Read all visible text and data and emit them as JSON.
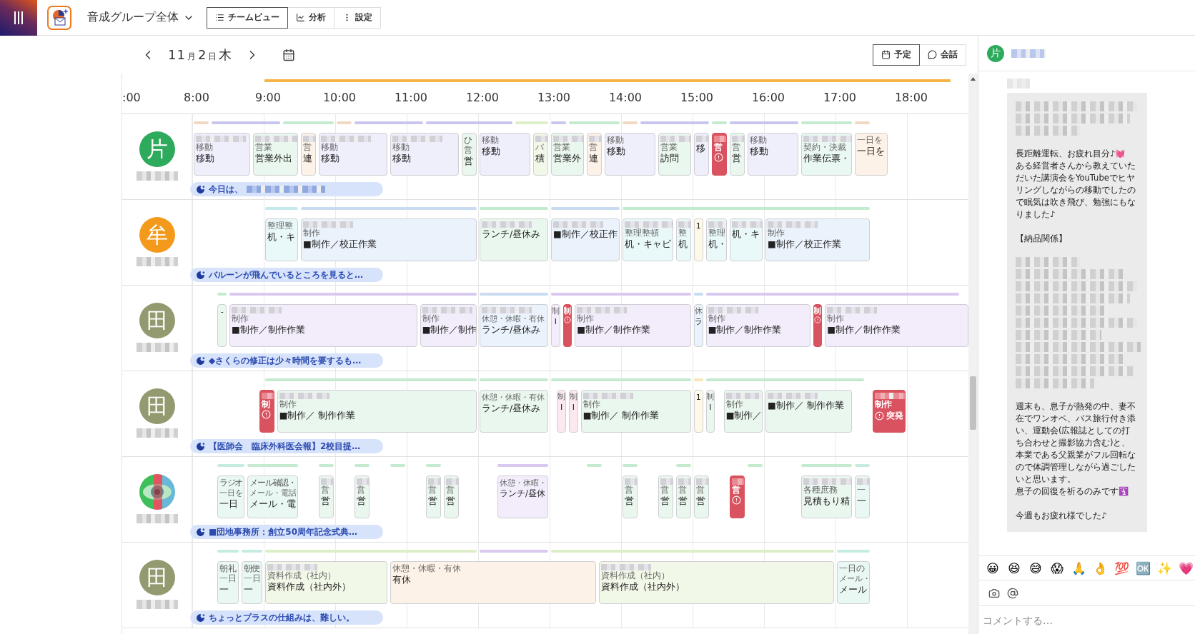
{
  "app_bar": {
    "group_select": "音成グループ全体",
    "tabs": [
      {
        "label": "チームビュー",
        "kind": "list",
        "selected": true
      },
      {
        "label": "分析",
        "kind": "chart",
        "selected": false
      },
      {
        "label": "設定",
        "kind": "more",
        "selected": false
      }
    ]
  },
  "date_nav": {
    "month": "11",
    "month_unit": "月",
    "day": "2",
    "day_unit": "日",
    "weekday": "木"
  },
  "view_toggle": [
    {
      "label": "予定",
      "kind": "calendar",
      "selected": true
    },
    {
      "label": "会話",
      "kind": "chat",
      "selected": false
    }
  ],
  "timeline": {
    "hours": [
      ":00",
      "8:00",
      "9:00",
      "10:00",
      "11:00",
      "12:00",
      "13:00",
      "14:00",
      "15:00",
      "16:00",
      "17:00",
      "18:00"
    ],
    "rows": [
      {
        "avatar": {
          "kind": "initial",
          "text": "片",
          "color": "#2eaa5c"
        },
        "bars": [
          {
            "color": "#f0d9c2"
          },
          {
            "color": "#c8c5ee"
          },
          {
            "color": "#c4ebcf"
          },
          {
            "color": "#f0d9c2"
          },
          {
            "color": "#c8c5ee"
          },
          {
            "color": "#c8c5ee"
          },
          {
            "color": "#dcefc8"
          },
          {
            "color": "#c8c5ee"
          },
          {
            "color": "#c4ebcf"
          },
          {
            "color": "#f0d9c2"
          },
          {
            "color": "#c8c5ee"
          },
          {
            "color": "#c4ebcf"
          },
          {
            "color": "#c8c5ee"
          },
          {
            "color": "#c4ebcf"
          },
          {
            "color": "#f0d9c2"
          }
        ],
        "events": [
          {
            "kind": "task",
            "color": "#efeefb",
            "title_redacted": true,
            "category": "移動",
            "text": "移動"
          },
          {
            "kind": "task",
            "color": "#eaf7ee",
            "title_redacted": true,
            "category": "営業",
            "text": "営業外出"
          },
          {
            "kind": "task",
            "color": "#fdf2e7",
            "title_redacted": true,
            "category": "営",
            "text": "連"
          },
          {
            "kind": "task",
            "color": "#efeefb",
            "title_redacted": true,
            "category": "移動",
            "text": "移動"
          },
          {
            "kind": "task",
            "color": "#efeefb",
            "title_redacted": true,
            "category": "移動",
            "text": "移動"
          },
          {
            "kind": "task",
            "color": "#eaf7ee",
            "title": "ひ",
            "category": "営",
            "text": "営"
          },
          {
            "kind": "task",
            "color": "#efeefb",
            "category": "移動",
            "text": "移動"
          },
          {
            "kind": "task",
            "color": "#f2f8e8",
            "title_redacted": true,
            "category": "バ",
            "text": "積"
          },
          {
            "kind": "task",
            "color": "#eaf7ee",
            "title_redacted": true,
            "category": "営業",
            "text": "営業外"
          },
          {
            "kind": "task",
            "color": "#fdf2e7",
            "title_redacted": true,
            "category": "営",
            "text": "連"
          },
          {
            "kind": "task",
            "color": "#efeefb",
            "category": "移動",
            "text": "移動"
          },
          {
            "kind": "task",
            "color": "#eaf7ee",
            "title_redacted": true,
            "category": "営業",
            "text": "訪問"
          },
          {
            "kind": "task",
            "color": "#efeefb",
            "title_redacted": true,
            "text": "移"
          },
          {
            "kind": "alert",
            "color": "#d9525f",
            "title_redacted": true,
            "category": "営"
          },
          {
            "kind": "task",
            "color": "#eaf7ee",
            "title_redacted": true,
            "category": "営",
            "text": "営"
          },
          {
            "kind": "task",
            "color": "#efeefb",
            "category": "移動",
            "text": "移動"
          },
          {
            "kind": "task",
            "color": "#eaf8f3",
            "title_redacted": true,
            "category": "契約・決裁",
            "text": "作業伝票・"
          },
          {
            "kind": "task",
            "color": "#fdf2e7",
            "category": "一日を",
            "text": "一日を"
          }
        ],
        "comment": {
          "text": "今日は、",
          "redacted": true
        }
      },
      {
        "avatar": {
          "kind": "initial",
          "text": "牟",
          "color": "#f39a1c"
        },
        "bars": [
          {
            "color": "#c6e9ec"
          },
          {
            "color": "#c8dbf0"
          },
          {
            "color": "#c4ebcf"
          },
          {
            "color": "#c8dbf0"
          },
          {
            "color": "#c4ebcf"
          }
        ],
        "events": [
          {
            "kind": "task",
            "color": "#e9f8f9",
            "category": "整理整",
            "text": "机・キ"
          },
          {
            "kind": "task",
            "color": "#eaf2fb",
            "title_redacted": true,
            "category": "制作",
            "text": "■制作／校正作業"
          },
          {
            "kind": "task",
            "color": "#eaf7ee",
            "title_redacted": true,
            "text": "ランチ/昼休み"
          },
          {
            "kind": "task",
            "color": "#eaf2fb",
            "title_redacted": true,
            "text": "■制作／校正作"
          },
          {
            "kind": "task",
            "color": "#e9f8f9",
            "title_redacted": true,
            "category": "整理整頓",
            "text": "机・キャビ"
          },
          {
            "kind": "task",
            "color": "#e9f8f9",
            "title_redacted": true,
            "category": "整",
            "text": "机"
          },
          {
            "kind": "task",
            "color": "#fdf9e6",
            "text": "1"
          },
          {
            "kind": "task",
            "color": "#e9f8f9",
            "title_redacted": true,
            "category": "整理",
            "text": "机・"
          },
          {
            "kind": "task",
            "color": "#e9f8f9",
            "title_redacted": true,
            "text": "机・キ"
          },
          {
            "kind": "task",
            "color": "#eaf2fb",
            "title_redacted": true,
            "category": "制作",
            "text": "■制作／校正作業"
          }
        ],
        "comment": {
          "text": "バルーンが飛んでいるところを見ると…"
        }
      },
      {
        "avatar": {
          "kind": "initial",
          "text": "田",
          "color": "#949a6f"
        },
        "bars": [
          {
            "color": "#c4ebcf"
          },
          {
            "color": "#d9c8f0"
          },
          {
            "color": "#c8dbf0"
          },
          {
            "color": "#d9c8f0"
          },
          {
            "color": "#c8dbf0"
          },
          {
            "color": "#d9c8f0"
          }
        ],
        "events": [
          {
            "kind": "task",
            "color": "#eaf7ee",
            "text": "-"
          },
          {
            "kind": "task",
            "color": "#f3edfb",
            "title_redacted": true,
            "category": "制作",
            "text": "■制作／制作作業"
          },
          {
            "kind": "task",
            "color": "#f3edfb",
            "title_redacted": true,
            "category": "制作",
            "text": "■制作／制作"
          },
          {
            "kind": "task",
            "color": "#eaf2fb",
            "title_redacted": true,
            "category": "休憩・休暇・有休",
            "text": "ランチ/昼休み"
          },
          {
            "kind": "task",
            "color": "#f3edfb",
            "category": "制",
            "text": "I"
          },
          {
            "kind": "alert",
            "color": "#d9525f",
            "category": "制"
          },
          {
            "kind": "task",
            "color": "#f3edfb",
            "title_redacted": true,
            "category": "制作",
            "text": "■制作／制作作業"
          },
          {
            "kind": "task",
            "color": "#eaf2fb",
            "category": "休",
            "text": "ラ"
          },
          {
            "kind": "task",
            "color": "#f3edfb",
            "title_redacted": true,
            "category": "制作",
            "text": "■制作／制作作業"
          },
          {
            "kind": "alert",
            "color": "#d9525f",
            "category": "制"
          },
          {
            "kind": "task",
            "color": "#f3edfb",
            "title_redacted": true,
            "category": "制作",
            "text": "■制作／制作作業"
          }
        ],
        "comment": {
          "text": "◆さくらの修正は少々時間を要するも…"
        }
      },
      {
        "avatar": {
          "kind": "initial",
          "text": "田",
          "color": "#949a6f"
        },
        "bars": [
          {
            "color": "#c4ebcf"
          },
          {
            "color": "#c4ebcf"
          },
          {
            "color": "#c4ebcf"
          },
          {
            "color": "#f5e8b8"
          },
          {
            "color": "#c4ebcf"
          }
        ],
        "events": [
          {
            "kind": "alert",
            "color": "#d9525f",
            "title_redacted": true,
            "category": "制"
          },
          {
            "kind": "task",
            "color": "#eaf7ee",
            "title_redacted": true,
            "category": "制作",
            "text": "■制作／ 制作作業"
          },
          {
            "kind": "task",
            "color": "#eaf7ee",
            "category": "休憩・休暇・有休",
            "text": "ランチ/昼休み"
          },
          {
            "kind": "task",
            "color": "#fbe9ef",
            "category": "制",
            "text": "I"
          },
          {
            "kind": "task",
            "color": "#fbe9ef",
            "category": "制",
            "text": "I"
          },
          {
            "kind": "task",
            "color": "#eaf7ee",
            "title_redacted": true,
            "category": "制作",
            "text": "■制作／ 制作作業"
          },
          {
            "kind": "task",
            "color": "#fdf9e6",
            "text": "1"
          },
          {
            "kind": "task",
            "color": "#eaf7ee",
            "category": "制",
            "text": "I"
          },
          {
            "kind": "task",
            "color": "#eaf7ee",
            "title_redacted": true,
            "category": "制作",
            "text": "■制作／"
          },
          {
            "kind": "task",
            "color": "#eaf7ee",
            "title_redacted": true,
            "text": "■制作／ 制作作業"
          },
          {
            "kind": "alert",
            "color": "#d9525f",
            "title_redacted": true,
            "category": "制作",
            "note": "突発"
          }
        ],
        "comment": {
          "text": "【医師会　臨床外科医会報】2校目提…"
        }
      },
      {
        "avatar": {
          "kind": "picture"
        },
        "bars": [
          {
            "color": "#c6ece0"
          },
          {
            "color": "#c4ebcf"
          },
          {
            "color": "#c4ebcf"
          },
          {
            "color": "#c4ebcf"
          },
          {
            "color": "#c4ebcf"
          },
          {
            "color": "#c4ebcf"
          },
          {
            "color": "#d9c8f0"
          },
          {
            "color": "#c4ebcf"
          },
          {
            "color": "#c4ebcf"
          },
          {
            "color": "#c4ebcf"
          },
          {
            "color": "#c4ebcf"
          },
          {
            "color": "#c4ebcf"
          },
          {
            "color": "#c6ece0"
          }
        ],
        "events": [
          {
            "kind": "task",
            "color": "#eaf8f3",
            "title": "ラジオ",
            "category": "一日を",
            "text": "一日"
          },
          {
            "kind": "task",
            "color": "#eaf8f3",
            "title": "メール確認・",
            "category": "メール・電話",
            "text": "メール・電"
          },
          {
            "kind": "task",
            "color": "#eaf7ee",
            "title_redacted": true,
            "category": "営",
            "text": "営"
          },
          {
            "kind": "task",
            "color": "#eaf7ee",
            "title_redacted": true,
            "category": "営",
            "text": "営"
          },
          {
            "kind": "task",
            "color": "#eaf7ee",
            "title_redacted": true,
            "category": "営",
            "text": "営"
          },
          {
            "kind": "task",
            "color": "#eaf7ee",
            "title_redacted": true,
            "category": "営",
            "text": "営"
          },
          {
            "kind": "task",
            "color": "#f3edfb",
            "category": "休憩・休暇・",
            "text": "ランチ/昼休"
          },
          {
            "kind": "task",
            "color": "#eaf7ee",
            "title_redacted": true,
            "category": "営",
            "text": "営"
          },
          {
            "kind": "task",
            "color": "#eaf7ee",
            "title_redacted": true,
            "category": "営",
            "text": "営"
          },
          {
            "kind": "task",
            "color": "#eaf7ee",
            "title_redacted": true,
            "category": "営",
            "text": "営"
          },
          {
            "kind": "task",
            "color": "#eaf7ee",
            "title_redacted": true,
            "category": "営",
            "text": "営"
          },
          {
            "kind": "alert",
            "color": "#d9525f",
            "title_redacted": true,
            "category": "営"
          },
          {
            "kind": "task",
            "color": "#eaf7ee",
            "title_redacted": true,
            "category": "各種庶務",
            "text": "見積もり精"
          },
          {
            "kind": "task",
            "color": "#eaf8f3",
            "title_redacted": true,
            "category": "一",
            "text": "一"
          }
        ],
        "comment": {
          "text": "■団地事務所：創立50周年記念式典…"
        }
      },
      {
        "avatar": {
          "kind": "initial",
          "text": "田",
          "color": "#949a6f"
        },
        "bars": [
          {
            "color": "#c6ece0"
          },
          {
            "color": "#c6ece0"
          },
          {
            "color": "#dcefc8"
          },
          {
            "color": "#d9c8f0"
          },
          {
            "color": "#dcefc8"
          },
          {
            "color": "#c6ece0"
          }
        ],
        "events": [
          {
            "kind": "task",
            "color": "#eaf8f3",
            "title": "朝礼",
            "category": "一日",
            "text": "一"
          },
          {
            "kind": "task",
            "color": "#eaf8f3",
            "title": "朝便",
            "category": "一日",
            "text": "一"
          },
          {
            "kind": "task",
            "color": "#f2f8e8",
            "title_redacted": true,
            "category": "資料作成（社内）",
            "text": "資料作成（社内外）"
          },
          {
            "kind": "task",
            "color": "#fdf2e7",
            "category": "休憩・休暇・有休",
            "text": "有休"
          },
          {
            "kind": "task",
            "color": "#f2f8e8",
            "title_redacted": true,
            "category": "資料作成（社内）",
            "text": "資料作成（社内外）"
          },
          {
            "kind": "task",
            "color": "#eaf8f3",
            "title": "一日の",
            "category": "メール・",
            "text": "メール"
          }
        ],
        "comment": {
          "text": "ちょっとプラスの仕組みは、難しい。"
        }
      }
    ]
  },
  "chat": {
    "author_initial": "片",
    "message": [
      {
        "kind": "mosaic"
      },
      {
        "kind": "text",
        "text": "長距離運転、お疲れ目分♪💓"
      },
      {
        "kind": "line",
        "text": "ある経営者さんから教えていただいた講演会をYouTubeでヒヤリングしながらの移動でしたので眠気は吹き飛び、勉強にもなりました♪"
      },
      {
        "kind": "text",
        "text": "【納品関係】"
      },
      {
        "kind": "mosaicblock"
      },
      {
        "kind": "text",
        "text": "週末も、息子が熱発の中、妻不在でワンオペ、バス旅行付き添い、運動会(広報誌としての打ち合わせと撮影協力含む)と、本業である父親業がフル回転なので体調管理しながら過ごしたいと思います。"
      },
      {
        "kind": "line",
        "text": "息子の回復を祈るのみです🛐"
      },
      {
        "kind": "text",
        "text": "今週もお疲れ様でした♪"
      }
    ],
    "reactions": [
      "😀",
      "😆",
      "😅",
      "😱",
      "🙏",
      "👌",
      "💯",
      "🆗",
      "✨",
      "💗"
    ],
    "comment_field": {
      "placeholder": "コメントする…"
    }
  }
}
